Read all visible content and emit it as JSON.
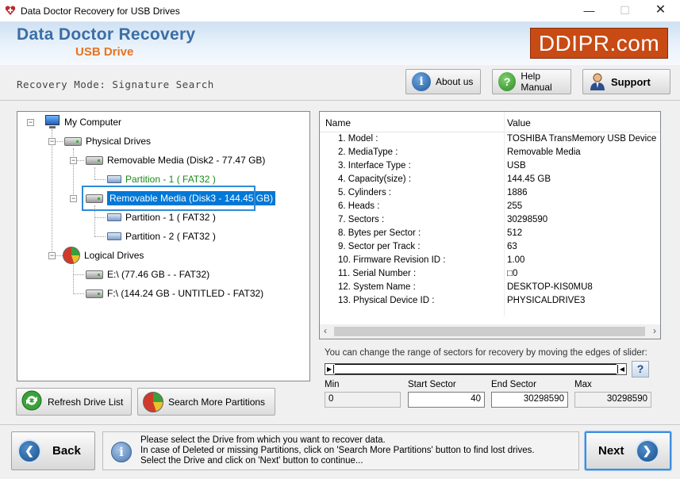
{
  "window": {
    "title": "Data Doctor Recovery for USB Drives",
    "min_glyph": "—",
    "max_glyph": "☐",
    "close_glyph": "✕"
  },
  "header": {
    "title": "Data Doctor Recovery",
    "subtitle": "USB Drive",
    "brand": "DDIPR.com"
  },
  "toolbar": {
    "mode_label": "Recovery Mode: Signature Search",
    "about_label": "About us",
    "help_label": "Help Manual",
    "support_label": "Support"
  },
  "tree": {
    "root": "My Computer",
    "physical": "Physical Drives",
    "disk2": "Removable Media (Disk2 - 77.47 GB)",
    "disk2_p1": "Partition - 1 ( FAT32 )",
    "disk3": "Removable Media (Disk3 - 144.45 GB)",
    "disk3_p1": "Partition - 1 ( FAT32 )",
    "disk3_p2": "Partition - 2 ( FAT32 )",
    "logical": "Logical Drives",
    "e_drive": "E:\\ (77.46 GB -  - FAT32)",
    "f_drive": "F:\\ (144.24 GB - UNTITLED - FAT32)"
  },
  "left_buttons": {
    "refresh": "Refresh Drive List",
    "search_more": "Search More Partitions"
  },
  "properties": {
    "col_name": "Name",
    "col_value": "Value",
    "rows": [
      {
        "k": "1. Model :",
        "v": "TOSHIBA TransMemory USB Device"
      },
      {
        "k": "2. MediaType :",
        "v": "Removable Media"
      },
      {
        "k": "3. Interface Type :",
        "v": "USB"
      },
      {
        "k": "4. Capacity(size) :",
        "v": "144.45 GB"
      },
      {
        "k": "5. Cylinders :",
        "v": "1886"
      },
      {
        "k": "6. Heads :",
        "v": "255"
      },
      {
        "k": "7. Sectors :",
        "v": "30298590"
      },
      {
        "k": "8. Bytes per Sector :",
        "v": "512"
      },
      {
        "k": "9. Sector per Track :",
        "v": "63"
      },
      {
        "k": "10. Firmware Revision ID :",
        "v": "1.00"
      },
      {
        "k": "11. Serial Number :",
        "v": "□0"
      },
      {
        "k": "12. System Name :",
        "v": "DESKTOP-KIS0MU8"
      },
      {
        "k": "13. Physical Device ID :",
        "v": "PHYSICALDRIVE3"
      }
    ]
  },
  "slider": {
    "instruction": "You can change the range of sectors for recovery by moving the edges of slider:",
    "help_glyph": "?",
    "min_label": "Min",
    "min_value": "0",
    "start_label": "Start Sector",
    "start_value": "40",
    "end_label": "End Sector",
    "end_value": "30298590",
    "max_label": "Max",
    "max_value": "30298590"
  },
  "footer": {
    "back": "Back",
    "next": "Next",
    "info_line1": "Please select the Drive from which you want to recover data.",
    "info_line2": "In case of Deleted or missing Partitions, click on 'Search More Partitions' button to find lost drives.",
    "info_line3": "Select the Drive and click on 'Next' button to continue..."
  }
}
